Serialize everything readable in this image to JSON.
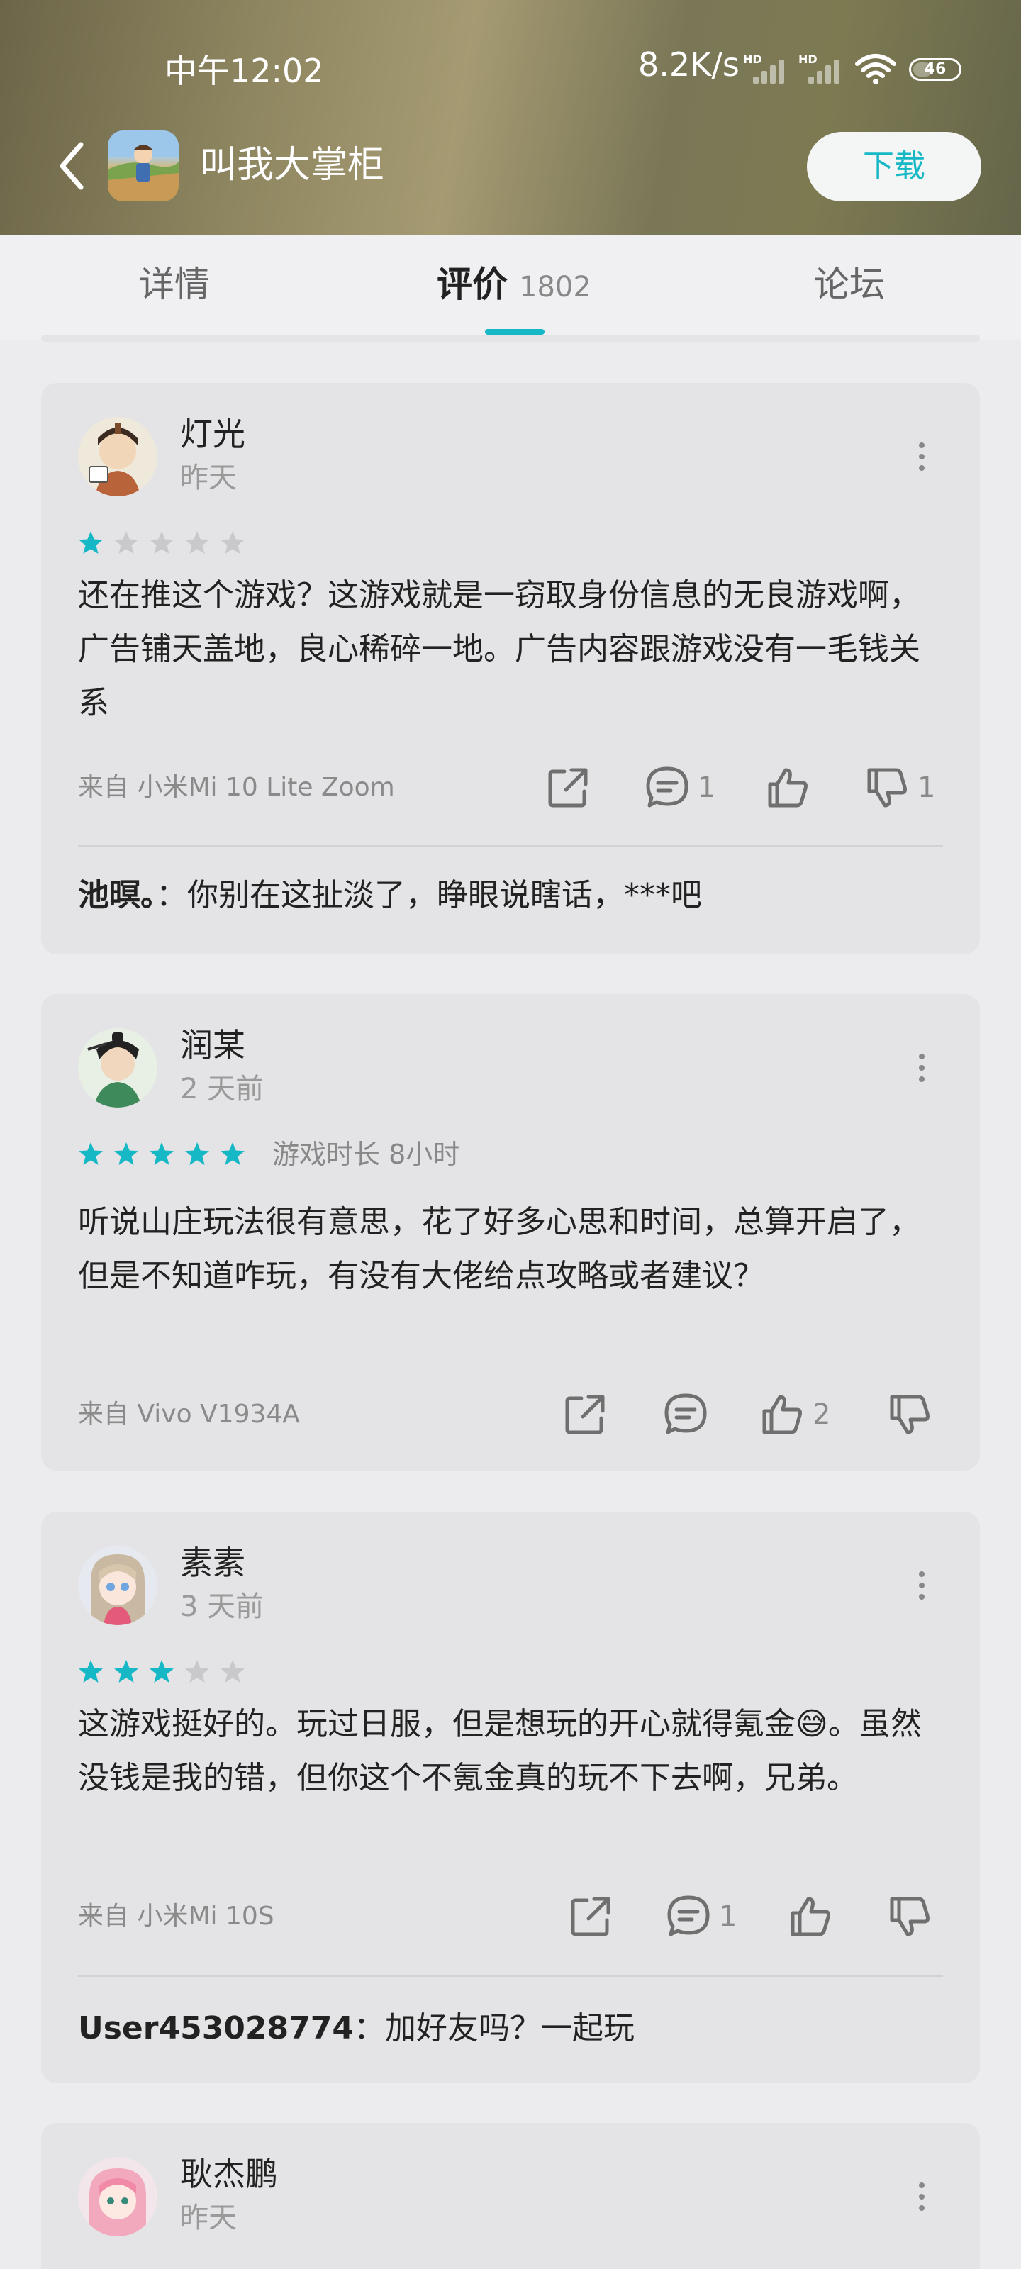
{
  "status_bar": {
    "time": "中午12:02",
    "network_speed": "8.2K/s",
    "battery": "46"
  },
  "header": {
    "app_name": "叫我大掌柜",
    "download_label": "下载"
  },
  "tabs": [
    {
      "label": "详情"
    },
    {
      "label": "评价",
      "count": "1802"
    },
    {
      "label": "论坛"
    }
  ],
  "reviews": [
    {
      "user": "灯光",
      "date": "昨天",
      "rating": 1,
      "text": "还在推这个游戏？这游戏就是一窃取身份信息的无良游戏啊，广告铺天盖地，良心稀碎一地。广告内容跟游戏没有一毛钱关系",
      "device": "来自 小米Mi 10 Lite Zoom",
      "comments": "1",
      "likes": "",
      "dislikes": "1",
      "reply": {
        "user": "池暝。",
        "text": "：你别在这扯淡了，睁眼说瞎话，***吧"
      }
    },
    {
      "user": "润某",
      "date": "2 天前",
      "rating": 5,
      "playtime": "游戏时长 8小时",
      "text": "听说山庄玩法很有意思，花了好多心思和时间，总算开启了，但是不知道咋玩，有没有大佬给点攻略或者建议？",
      "device": "来自 Vivo V1934A",
      "comments": "",
      "likes": "2",
      "dislikes": ""
    },
    {
      "user": "素素",
      "date": "3 天前",
      "rating": 3,
      "text_part1": "这游戏挺好的。玩过日服，但是想玩的开心就得氪金",
      "emoji": "😅",
      "text_part2": "。虽然没钱是我的错，但你这个不氪金真的玩不下去啊，兄弟。",
      "device": "来自 小米Mi 10S",
      "comments": "1",
      "likes": "",
      "dislikes": "",
      "reply": {
        "user": "User453028774",
        "text": "：加好友吗？一起玩"
      }
    },
    {
      "user": "耿杰鹏",
      "date": "昨天"
    }
  ],
  "colors": {
    "accent": "#16b8c5",
    "card_bg": "#e4e4e6",
    "page_bg": "#ececee",
    "star_empty": "#c9c9cb"
  }
}
